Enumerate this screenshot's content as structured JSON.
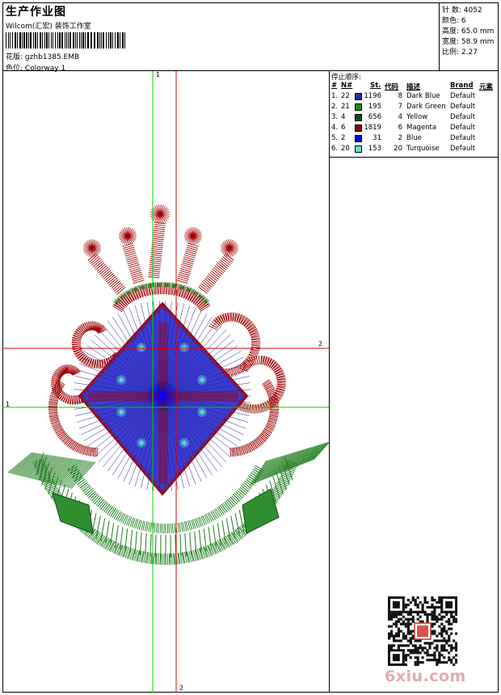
{
  "header": {
    "title": "生产作业图",
    "company": "Wilcom(汇宏) 装饰工作室",
    "design_label": "花版:",
    "design_value": "gzhb1385.EMB",
    "colorway_label": "色位:",
    "colorway_value": "Colorway 1"
  },
  "stats": [
    {
      "label": "针 数:",
      "value": "4052"
    },
    {
      "label": "颜色:",
      "value": "6"
    },
    {
      "label": "高度:",
      "value": "65.0 mm"
    },
    {
      "label": "宽度:",
      "value": "58.9 mm"
    },
    {
      "label": "比例:",
      "value": "2.27"
    }
  ],
  "stop_sequence": {
    "title": "停止顺序:",
    "headers": {
      "num": "#",
      "needle": "N#",
      "stitches": "St.",
      "code": "代码",
      "description": "描述",
      "brand": "Brand",
      "element": "元素"
    },
    "rows": [
      {
        "num": "1.",
        "needle": "22",
        "color": "#1f2fa0",
        "stitches": "1196",
        "code": "8",
        "description": "Dark Blue",
        "brand": "Default"
      },
      {
        "num": "2.",
        "needle": "21",
        "color": "#1c8a1c",
        "stitches": "195",
        "code": "7",
        "description": "Dark Green",
        "brand": "Default"
      },
      {
        "num": "3.",
        "needle": "4",
        "color": "#0b4d0b",
        "stitches": "656",
        "code": "4",
        "description": "Yellow",
        "brand": "Default"
      },
      {
        "num": "4.",
        "needle": "6",
        "color": "#8b0000",
        "stitches": "1819",
        "code": "6",
        "description": "Magenta",
        "brand": "Default"
      },
      {
        "num": "5.",
        "needle": "2",
        "color": "#0000ff",
        "stitches": "31",
        "code": "2",
        "description": "Blue",
        "brand": "Default"
      },
      {
        "num": "6.",
        "needle": "20",
        "color": "#66e0cf",
        "stitches": "153",
        "code": "20",
        "description": "Turquoise",
        "brand": "Default"
      }
    ]
  },
  "axes": {
    "green_v": "1",
    "red_h": "2",
    "green_h": "1",
    "red_v": "2"
  },
  "watermark": "6xiu.com"
}
